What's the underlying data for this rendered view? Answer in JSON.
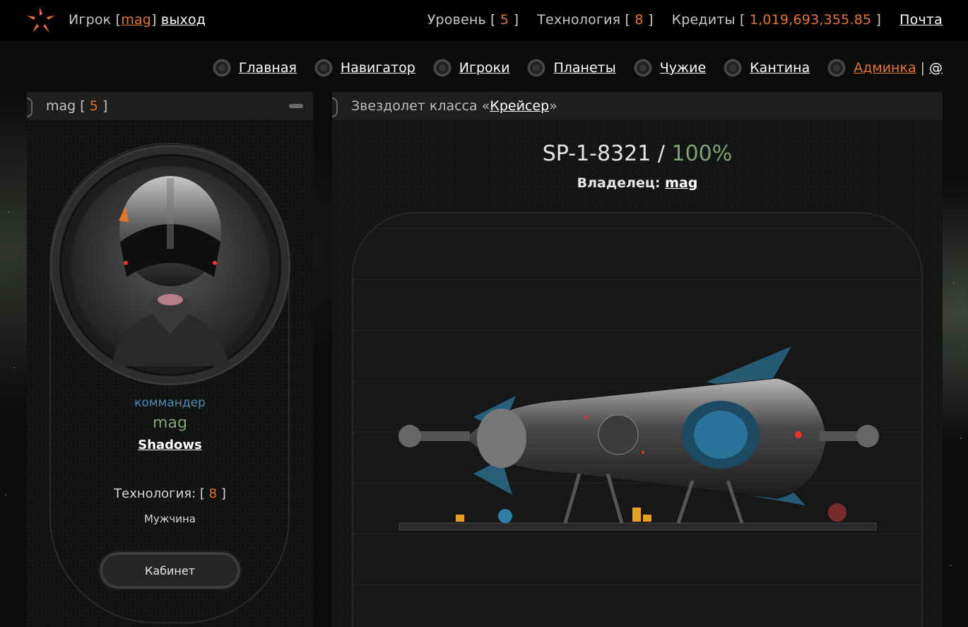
{
  "header": {
    "player_label": "Игрок",
    "player_name": "mag",
    "logout": "выход",
    "level_label": "Уровень",
    "level": "5",
    "tech_label": "Технология",
    "tech": "8",
    "credits_label": "Кредиты",
    "credits": "1,019,693,355.85",
    "mail": "Почта"
  },
  "nav": {
    "items": [
      {
        "label": "Главная"
      },
      {
        "label": "Навигатор"
      },
      {
        "label": "Игроки"
      },
      {
        "label": "Планеты"
      },
      {
        "label": "Чужие"
      },
      {
        "label": "Кантина"
      }
    ],
    "admin": "Админка",
    "separator": "|",
    "at": "@"
  },
  "profile": {
    "head_name": "mag",
    "head_level": "5",
    "rank": "коммандер",
    "name": "mag",
    "clan": "Shadows",
    "tech_label": "Технология:",
    "tech": "8",
    "gender": "Мужчина",
    "cabinet_button": "Кабинет"
  },
  "ship": {
    "head_prefix": "Звездолет класса «",
    "class_link": "Крейсер",
    "head_suffix": "»",
    "id": "SP-1-8321",
    "separator": " / ",
    "condition": "100%",
    "owner_label": "Владелец:",
    "owner": "mag"
  },
  "colors": {
    "accent": "#e8742a",
    "green": "#7ea270",
    "blue": "#4f8ab5"
  }
}
